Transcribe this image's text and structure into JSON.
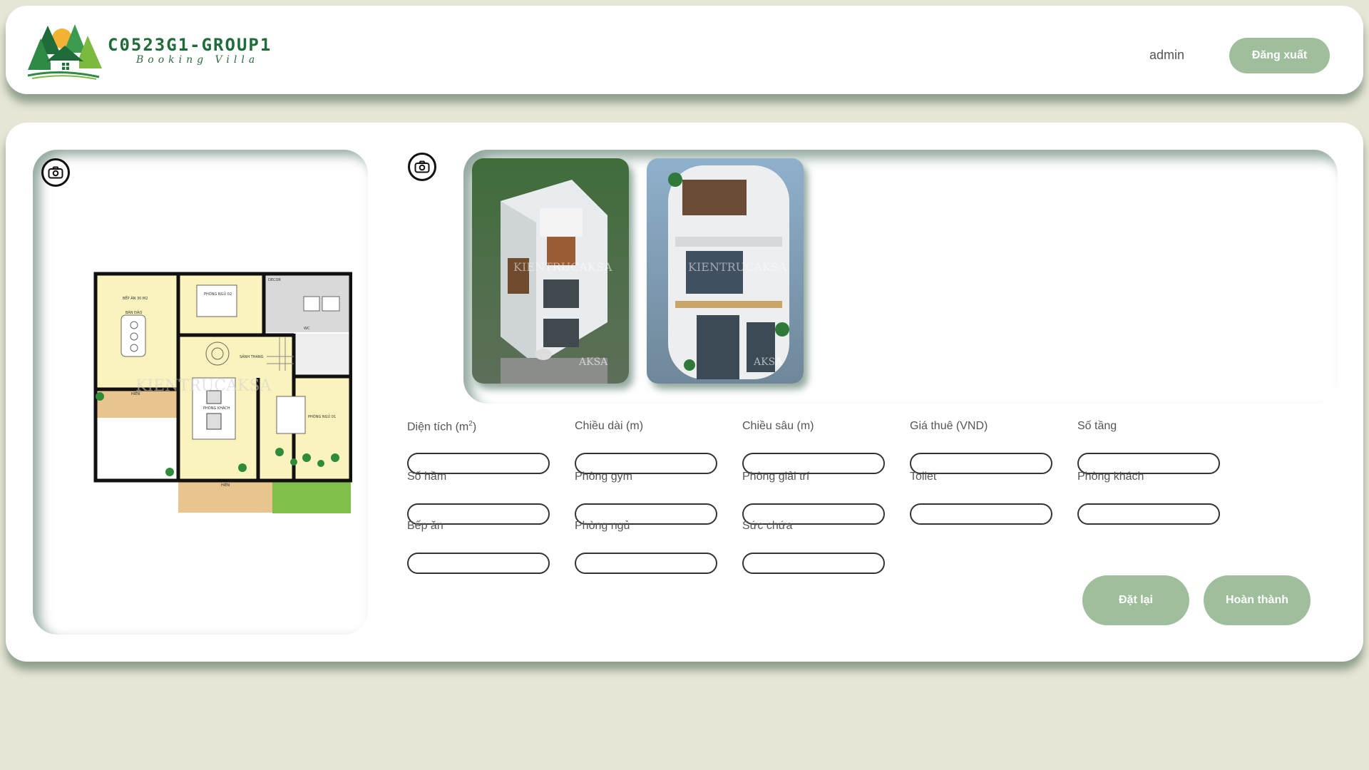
{
  "header": {
    "brand": "C0523G1-GROUP1",
    "tagline": "Booking Villa",
    "username": "admin",
    "logout_label": "Đăng xuất"
  },
  "floorplan": {
    "rooms": {
      "kitchen": "BẾP ĂN 30 M2",
      "island": "BÀN ĐẢO",
      "bedroom2": "PHÒNG NGỦ 02",
      "decor": "DECOR",
      "hall": "SẢNH THANG",
      "bedroom1": "PHÒNG NGỦ 01",
      "living": "PHÒNG KHÁCH",
      "porch": "HIÊN",
      "yard": "HIÊN",
      "wc": "WC"
    },
    "watermark": "KIENTRUCAKSA"
  },
  "gallery": {
    "watermark": "KIENTRUCAKSA",
    "logo": "AKSA"
  },
  "form": {
    "area": {
      "label": "Diện tích (m",
      "sup": "2",
      "close": ")",
      "value": ""
    },
    "length": {
      "label": "Chiều dài (m)",
      "value": ""
    },
    "depth": {
      "label": "Chiều sâu (m)",
      "value": ""
    },
    "price": {
      "label": "Giá thuê (VND)",
      "value": ""
    },
    "floors": {
      "label": "Số tầng",
      "value": ""
    },
    "basement": {
      "label": "Số hầm",
      "value": ""
    },
    "gym": {
      "label": "Phòng gym",
      "value": ""
    },
    "entertainment": {
      "label": "Phòng giải trí",
      "value": ""
    },
    "toilet": {
      "label": "Toilet",
      "value": ""
    },
    "guest": {
      "label": "Phòng khách",
      "value": ""
    },
    "kitchen": {
      "label": "Bếp ăn",
      "value": ""
    },
    "bedroom": {
      "label": "Phòng ngủ",
      "value": ""
    },
    "capacity": {
      "label": "Sức chứa",
      "value": ""
    }
  },
  "actions": {
    "reset_label": "Đặt lại",
    "submit_label": "Hoàn thành"
  },
  "colors": {
    "page_bg": "#e8e6d6",
    "accent": "#9fbf9c",
    "brand": "#1f6b3a"
  }
}
